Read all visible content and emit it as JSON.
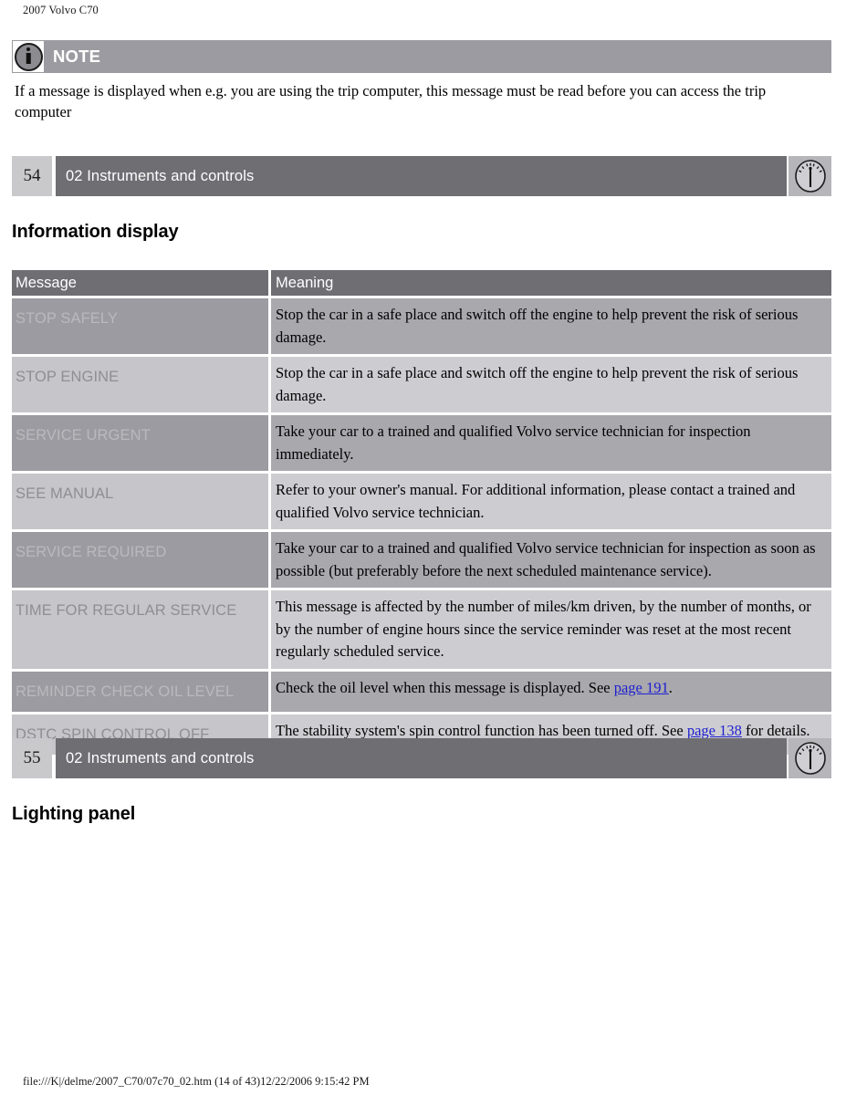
{
  "document": {
    "running_head": "2007 Volvo C70",
    "footer_path": "file:///K|/delme/2007_C70/07c70_02.htm (14 of 43)12/22/2006 9:15:42 PM"
  },
  "note": {
    "icon": "info-circle-icon",
    "label": "NOTE",
    "body": "If a message is displayed when e.g. you are using the trip computer, this message must be read before you can access the trip computer"
  },
  "page_bars": [
    {
      "number": "54",
      "title": "02 Instruments and controls",
      "icon": "gauge-icon"
    },
    {
      "number": "55",
      "title": "02 Instruments and controls",
      "icon": "gauge-icon"
    }
  ],
  "headings": {
    "information_display": "Information display",
    "lighting_panel": "Lighting panel"
  },
  "message_table": {
    "columns": [
      "Message",
      "Meaning"
    ],
    "rows": [
      {
        "message": "STOP SAFELY",
        "meaning": "Stop the car in a safe place and switch off the engine to help prevent the risk of serious damage.",
        "shade": "dark"
      },
      {
        "message": "STOP ENGINE",
        "meaning": "Stop the car in a safe place and switch off the engine to help prevent the risk of serious damage.",
        "shade": "light"
      },
      {
        "message": "SERVICE URGENT",
        "meaning": "Take your car to a trained and qualified Volvo service technician for inspection immediately.",
        "shade": "dark"
      },
      {
        "message": "SEE MANUAL",
        "meaning": "Refer to your owner's manual. For additional information, please contact a trained and qualified Volvo service technician.",
        "shade": "light"
      },
      {
        "message": "SERVICE REQUIRED",
        "meaning": "Take your car to a trained and qualified Volvo service technician for inspection as soon as possible (but preferably before the next scheduled maintenance service).",
        "shade": "dark"
      },
      {
        "message": "TIME FOR REGULAR SERVICE",
        "meaning": "This message is affected by the number of miles/km driven, by the number of months, or by the number of engine hours since the service reminder was reset at the most recent regularly scheduled service.",
        "shade": "light"
      },
      {
        "message": "REMINDER CHECK OIL LEVEL",
        "meaning_prefix": "Check the oil level when this message is displayed. See ",
        "link_text": "page 191",
        "meaning_suffix": ".",
        "shade": "dark"
      },
      {
        "message": "DSTC SPIN CONTROL OFF",
        "meaning_prefix": "The stability system's spin control function has been turned off. See ",
        "link_text": "page 138",
        "meaning_suffix": " for details.",
        "shade": "light"
      }
    ]
  },
  "colors": {
    "bar_dark": "#6e6e73",
    "note_bar": "#9b9ba1",
    "row_dark_msg": "#9b9ba1",
    "row_dark_mean": "#a8a8ad",
    "row_light_msg": "#c6c6ca",
    "row_light_mean": "#cdcdd1",
    "page_number_box": "#c9c9cc",
    "link": "#2020d0"
  }
}
